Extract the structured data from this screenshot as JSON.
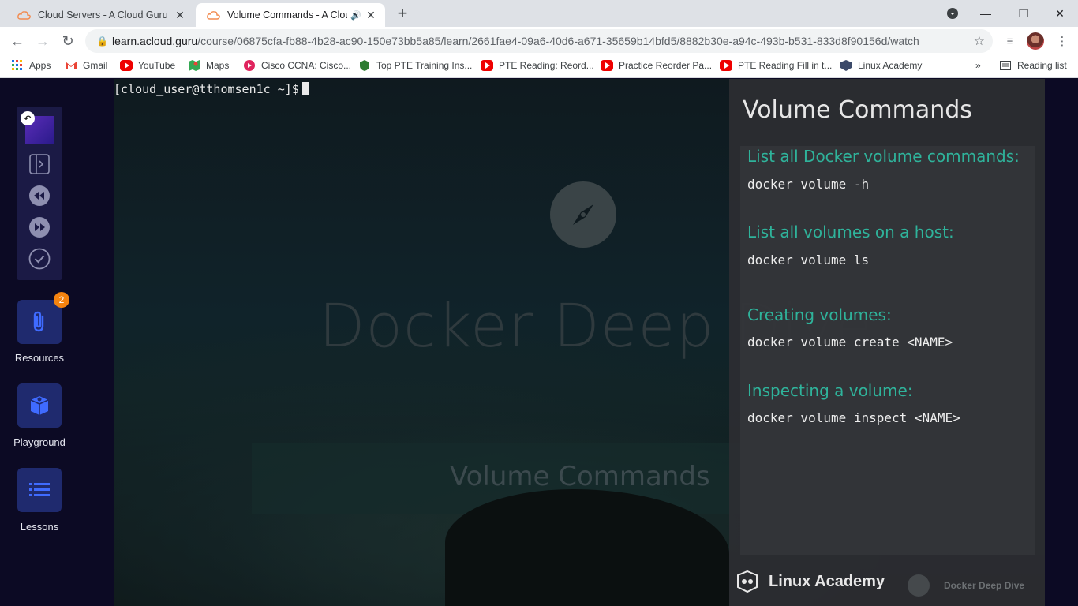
{
  "browser": {
    "tabs": [
      {
        "title": "Cloud Servers - A Cloud Guru",
        "active": false
      },
      {
        "title": "Volume Commands - A Cloud Guru",
        "active": true
      }
    ],
    "window_controls": {
      "minimize": "—",
      "maximize": "❐",
      "close": "✕"
    },
    "address": {
      "host": "learn.acloud.guru",
      "path": "/course/06875cfa-fb88-4b28-ac90-150e73bb5a85/learn/2661fae4-09a6-40d6-a671-35659b14bfd5/8882b30e-a94c-493b-b531-833d8f90156d/watch"
    },
    "bookmarks": [
      {
        "label": "Apps",
        "icon": "apps-grid-icon"
      },
      {
        "label": "Gmail",
        "icon": "gmail-icon"
      },
      {
        "label": "YouTube",
        "icon": "youtube-icon"
      },
      {
        "label": "Maps",
        "icon": "maps-icon"
      },
      {
        "label": "Cisco CCNA: Cisco...",
        "icon": "cisco-icon"
      },
      {
        "label": "Top PTE Training Ins...",
        "icon": "pte-training-icon"
      },
      {
        "label": "PTE Reading: Reord...",
        "icon": "youtube-icon"
      },
      {
        "label": "Practice Reorder Pa...",
        "icon": "youtube-icon"
      },
      {
        "label": "PTE Reading Fill in t...",
        "icon": "youtube-icon"
      },
      {
        "label": "Linux Academy",
        "icon": "linux-academy-icon"
      }
    ],
    "bookmarks_overflow": "»",
    "reading_list": "Reading list"
  },
  "sidebar": {
    "resources_label": "Resources",
    "resources_badge": "2",
    "playground_label": "Playground",
    "lessons_label": "Lessons"
  },
  "video": {
    "terminal_prompt": "[cloud_user@tthomsen1c ~]$",
    "background_title": "Docker Deep Dive",
    "background_subtitle": "Volume Commands"
  },
  "slide": {
    "title": "Volume Commands",
    "sections": [
      {
        "heading": "List all Docker volume commands:",
        "command": "docker volume -h"
      },
      {
        "heading": "List all volumes on a host:",
        "command": "docker volume ls"
      },
      {
        "heading": "Creating volumes:",
        "command": "docker volume create <NAME>"
      },
      {
        "heading": "Inspecting a volume:",
        "command": "docker volume inspect <NAME>"
      }
    ],
    "footer_brand": "Linux Academy",
    "footer_course": "Docker Deep Dive"
  },
  "colors": {
    "accent_teal": "#2fb39b",
    "badge_orange": "#f5830f",
    "sidebar_bg": "#0c0a24",
    "nav_card": "#1f2a6e"
  }
}
